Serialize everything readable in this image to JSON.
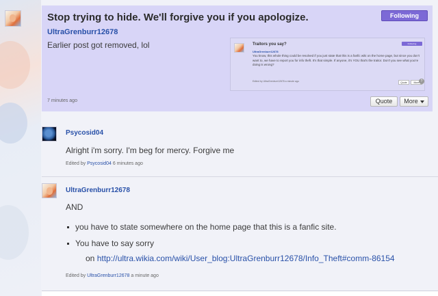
{
  "op": {
    "title": "Stop trying to hide. We'll forgive you if you apologize.",
    "follow_label": "Following",
    "author": "UltraGrenburr12678",
    "body": "Earlier post got removed, lol",
    "time": "7 minutes ago",
    "quote_label": "Quote",
    "more_label": "More",
    "embedded": {
      "title": "Traitors you say?",
      "follow_label": "Following",
      "author": "UltraGrenburr12678",
      "text": "You know, this whole thing could be resolved if you just state that this is a fanfic wiki on the home page, but since you don't want to, we have to report you for info theft. It's that simple. If anyone, it's YOU that's the traitor. Don't you see what you're doing is wrong?",
      "footer": "Edited by UltraGrenburr12678 a minute ago",
      "quote_label": "Quote",
      "more_label": "More",
      "help_glyph": "?"
    }
  },
  "replies": [
    {
      "author": "Psycosid04",
      "body": "Alright i'm sorry. I'm beg for mercy. Forgive me",
      "edited_prefix": "Edited by",
      "edited_by": "Psycosid04",
      "time": "6 minutes ago"
    },
    {
      "author": "UltraGrenburr12678",
      "intro": "AND",
      "bullets": [
        "you have to state somewhere on the home page that this is a fanfic site.",
        "You have to say sorry"
      ],
      "link_prefix": "on",
      "link_url": "http://ultra.wikia.com/wiki/User_blog:UltraGrenburr12678/Info_Theft#comm-86154",
      "edited_prefix": "Edited by",
      "edited_by": "UltraGrenburr12678",
      "time": "a minute ago"
    }
  ],
  "colors": {
    "op_background": "#d8d5f7",
    "follow_button": "#7c69d6",
    "link": "#2850a8"
  }
}
